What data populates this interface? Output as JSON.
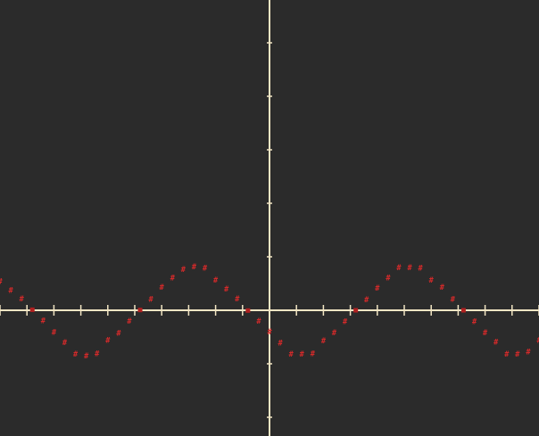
{
  "chart_data": {
    "type": "line",
    "title": "",
    "xlabel": "",
    "ylabel": "",
    "xlim": [
      -10,
      10
    ],
    "ylim": [
      -4.7,
      11.6
    ],
    "grid": false,
    "legend": "none",
    "series": [
      {
        "marker": "#",
        "color": "#d42a2a",
        "x": [
          -10.0,
          -9.6,
          -9.2,
          -8.8,
          -8.4,
          -8.0,
          -7.6,
          -7.2,
          -6.8,
          -6.4,
          -6.0,
          -5.6,
          -5.2,
          -4.8,
          -4.4,
          -4.0,
          -3.6,
          -3.2,
          -2.8,
          -2.4,
          -2.0,
          -1.6,
          -1.2,
          -0.8,
          -0.4,
          0.0,
          0.4,
          0.8,
          1.2,
          1.6,
          2.0,
          2.4,
          2.8,
          3.2,
          3.6,
          4.0,
          4.4,
          4.8,
          5.2,
          5.6,
          6.0,
          6.4,
          6.8,
          7.2,
          7.6,
          8.0,
          8.4,
          8.8,
          9.2,
          9.6,
          10.0
        ],
        "y": [
          1.09,
          0.75,
          0.44,
          0.02,
          -0.39,
          -0.81,
          -1.2,
          -1.63,
          -1.7,
          -1.61,
          -1.11,
          -0.85,
          -0.4,
          0.01,
          0.41,
          0.86,
          1.21,
          1.54,
          1.64,
          1.59,
          1.14,
          0.8,
          0.43,
          -0.01,
          -0.4,
          -0.8,
          -1.21,
          -1.64,
          -1.64,
          -1.62,
          -1.13,
          -0.84,
          -0.41,
          0.0,
          0.4,
          0.83,
          1.21,
          1.6,
          1.6,
          1.58,
          1.13,
          0.86,
          0.41,
          0.0,
          -0.41,
          -0.84,
          -1.19,
          -1.63,
          -1.63,
          -1.55,
          -1.11
        ]
      }
    ],
    "xticks_step": 1,
    "yticks_step": 2
  }
}
